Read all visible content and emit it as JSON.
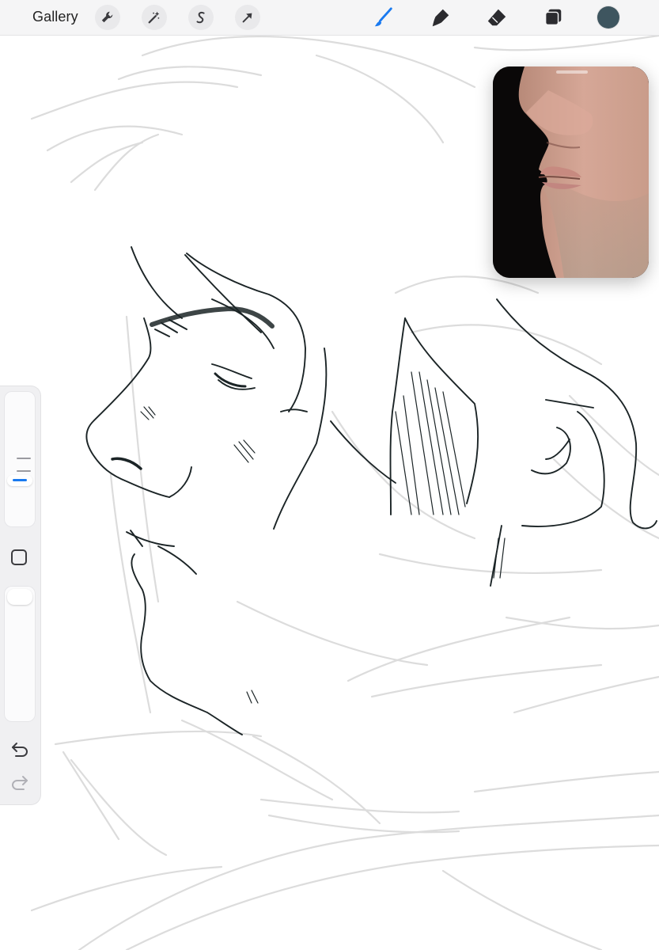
{
  "toolbar": {
    "gallery_label": "Gallery",
    "left_tools": [
      "wrench-icon",
      "magic-wand-icon",
      "selection-s-icon",
      "transform-arrow-icon"
    ],
    "right_tools": [
      "brush-icon",
      "smudge-icon",
      "eraser-icon",
      "layers-icon"
    ],
    "active_tool": "brush-icon",
    "accent_color": "#1a7af0",
    "current_color": "#3e555f"
  },
  "sidebar": {
    "brush_size_level": 0.82,
    "opacity_level": 0.0,
    "modify_button": "square-icon",
    "undo_icon": "undo-icon",
    "redo_icon": "redo-icon"
  },
  "reference": {
    "subject": "reference-photo-profile",
    "background": "#0a0808"
  },
  "canvas": {
    "sketch_color": "#1b2426",
    "rough_line_color": "#dcdcdc"
  }
}
